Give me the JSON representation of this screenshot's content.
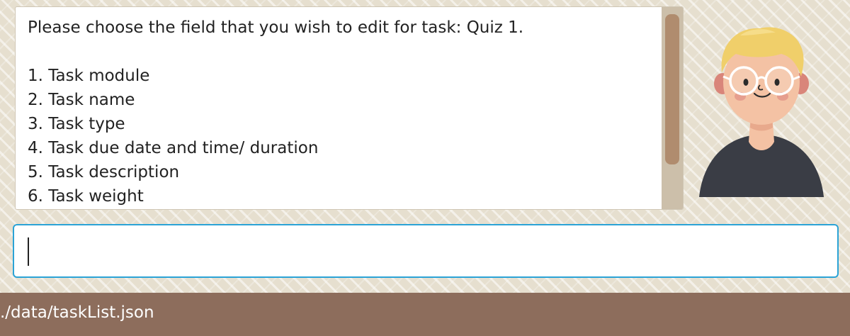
{
  "result_display": {
    "text": "Please choose the field that you wish to edit for task: Quiz 1.\n\n1. Task module\n2. Task name\n3. Task type\n4. Task due date and time/ duration\n5. Task description\n6. Task weight"
  },
  "command_box": {
    "value": ""
  },
  "status_bar": {
    "file_path": "./data/taskList.json"
  },
  "avatar": {
    "icon": "cartoon-person-with-glasses"
  },
  "colors": {
    "background": "#e6dfcf",
    "scroll_track": "#ccbfaa",
    "scroll_thumb": "#b08c6e",
    "command_border": "#2ba3d6",
    "status_bar": "#8d6d5c",
    "avatar_hair": "#f0cf6a",
    "avatar_skin": "#f4c2a4",
    "avatar_shirt": "#3a3d45"
  }
}
